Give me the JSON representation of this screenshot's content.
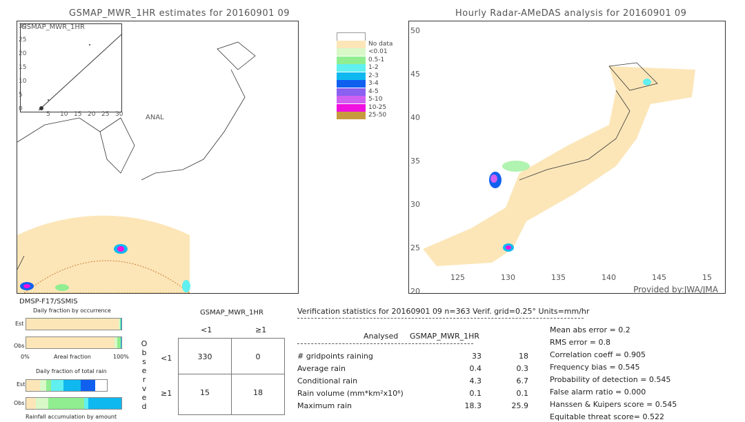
{
  "left_title": "GSMAP_MWR_1HR estimates for 20160901 09",
  "right_title": "Hourly Radar-AMeDAS analysis for 20160901 09",
  "inset": {
    "ylabel": "GSMAP_MWR_1HR",
    "xlabel": "ANAL",
    "ticks": [
      "0",
      "5",
      "10",
      "15",
      "20",
      "25",
      "30"
    ]
  },
  "right_map": {
    "lat_ticks": [
      "20",
      "25",
      "30",
      "35",
      "40",
      "45",
      "50"
    ],
    "lon_ticks": [
      "125",
      "130",
      "135",
      "140",
      "145",
      "15"
    ],
    "credit": "Provided by:JWA/JMA"
  },
  "legend": [
    {
      "label": "",
      "color": "#ffffff"
    },
    {
      "label": "No data",
      "color": "#fce6b8"
    },
    {
      "label": "<0.01",
      "color": "#d8f8c8"
    },
    {
      "label": "0.5-1",
      "color": "#90ee90"
    },
    {
      "label": "1-2",
      "color": "#60f0f0"
    },
    {
      "label": "2-3",
      "color": "#10b8f0"
    },
    {
      "label": "3-4",
      "color": "#1060f0"
    },
    {
      "label": "4-5",
      "color": "#8a60f0"
    },
    {
      "label": "5-10",
      "color": "#d060f0"
    },
    {
      "label": "10-25",
      "color": "#f010e0"
    },
    {
      "label": "25-50",
      "color": "#c89a40"
    }
  ],
  "satellite": "DMSP-F17/SSMIS",
  "occurrence": {
    "title": "Daily fraction by occurrence",
    "est": "Est",
    "obs": "Obs",
    "x0": "0%",
    "xlabel": "Areal fraction",
    "x1": "100%",
    "est_fracs": [
      {
        "v": 0.97,
        "c": "#fce6b8"
      },
      {
        "v": 0.015,
        "c": "#d8f8c8"
      },
      {
        "v": 0.01,
        "c": "#90ee90"
      },
      {
        "v": 0.005,
        "c": "#10b8f0"
      }
    ],
    "obs_fracs": [
      {
        "v": 0.93,
        "c": "#fce6b8"
      },
      {
        "v": 0.03,
        "c": "#d8f8c8"
      },
      {
        "v": 0.035,
        "c": "#90ee90"
      },
      {
        "v": 0.005,
        "c": "#10b8f0"
      }
    ]
  },
  "total_rain": {
    "title": "Daily fraction of total rain",
    "est": "Est",
    "obs": "Obs",
    "xlabel": "Rainfall accumulation by amount",
    "est_fracs": [
      {
        "v": 0.17,
        "c": "#fce6b8"
      },
      {
        "v": 0.08,
        "c": "#d8f8c8"
      },
      {
        "v": 0.06,
        "c": "#90ee90"
      },
      {
        "v": 0.15,
        "c": "#60f0f0"
      },
      {
        "v": 0.21,
        "c": "#10b8f0"
      },
      {
        "v": 0.18,
        "c": "#1060f0"
      }
    ],
    "obs_fracs": [
      {
        "v": 0.1,
        "c": "#fce6b8"
      },
      {
        "v": 0.13,
        "c": "#d8f8c8"
      },
      {
        "v": 0.38,
        "c": "#90ee90"
      },
      {
        "v": 0.04,
        "c": "#60f0f0"
      },
      {
        "v": 0.35,
        "c": "#10b8f0"
      }
    ]
  },
  "contingency": {
    "header": "GSMAP_MWR_1HR",
    "col_lt": "<1",
    "col_ge": "≥1",
    "row_lt": "<1",
    "row_ge": "≥1",
    "observed": "Observed",
    "cells": [
      "330",
      "0",
      "15",
      "18"
    ]
  },
  "verif": {
    "header": "Verification statistics for 20160901 09   n=363   Verif. grid=0.25°   Units=mm/hr",
    "col1": "Analysed",
    "col2": "GSMAP_MWR_1HR",
    "rows": [
      {
        "label": "# gridpoints raining",
        "a": "33",
        "b": "18"
      },
      {
        "label": "Average rain",
        "a": "0.4",
        "b": "0.3"
      },
      {
        "label": "Conditional rain",
        "a": "4.3",
        "b": "6.7"
      },
      {
        "label": "Rain volume (mm*km²x10⁶)",
        "a": "0.1",
        "b": "0.1"
      },
      {
        "label": "Maximum rain",
        "a": "18.3",
        "b": "25.9"
      }
    ]
  },
  "scores": [
    "Mean abs error = 0.2",
    "RMS error = 0.8",
    "Correlation coeff = 0.905",
    "Frequency bias = 0.545",
    "Probability of detection = 0.545",
    "False alarm ratio = 0.000",
    "Hanssen & Kuipers score = 0.545",
    "Equitable threat score= 0.522"
  ]
}
